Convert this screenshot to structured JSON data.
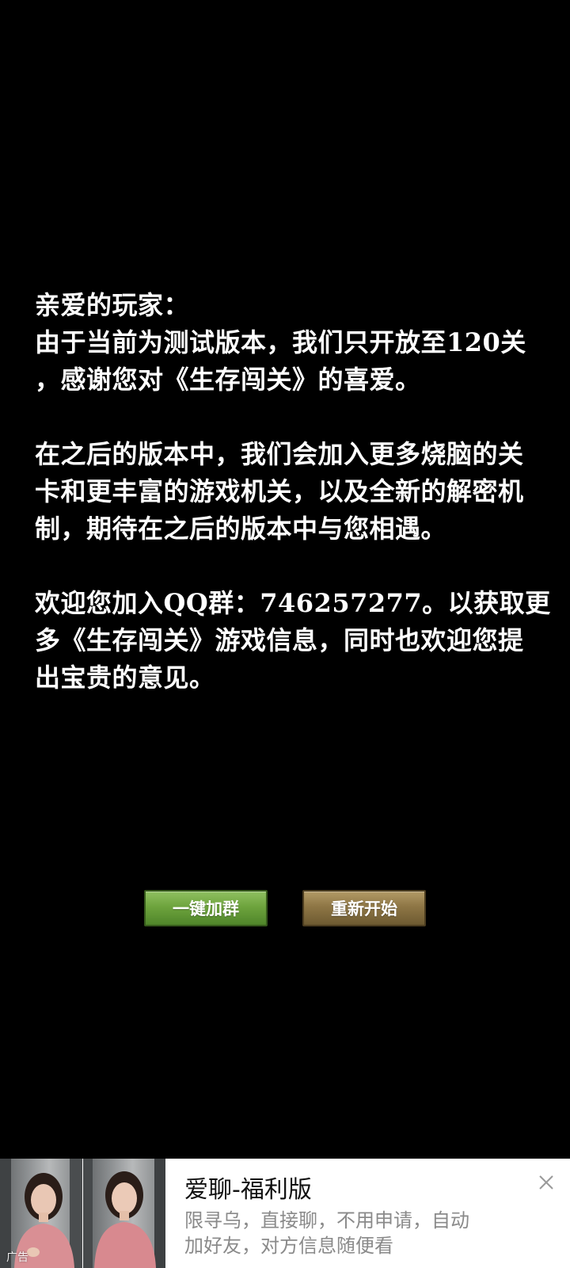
{
  "message": {
    "greeting": "亲爱的玩家：",
    "p1_line1": "由于当前为测试版本，我们只开放至120关",
    "p1_line2": "，感谢您对《生存闯关》的喜爱。",
    "p2_line1": "在之后的版本中，我们会加入更多烧脑的关",
    "p2_line2": "卡和更丰富的游戏机关，以及全新的解密机",
    "p2_line3": "制，期待在之后的版本中与您相遇。",
    "p3_line1": "欢迎您加入QQ群：746257277。以获取更",
    "p3_line2": "多《生存闯关》游戏信息，同时也欢迎您提",
    "p3_line3": "出宝贵的意见。"
  },
  "buttons": {
    "join_group": "一键加群",
    "restart": "重新开始"
  },
  "ad": {
    "label": "广告",
    "title": "爱聊-福利版",
    "desc_line1": "限寻乌，直接聊，不用申请，自动",
    "desc_line2": "加好友，对方信息随便看"
  },
  "colors": {
    "background": "#000000",
    "text": "#ffffff",
    "join_button": "#6ea43d",
    "restart_button": "#8e7645"
  },
  "icons": {
    "close": "close-icon"
  }
}
